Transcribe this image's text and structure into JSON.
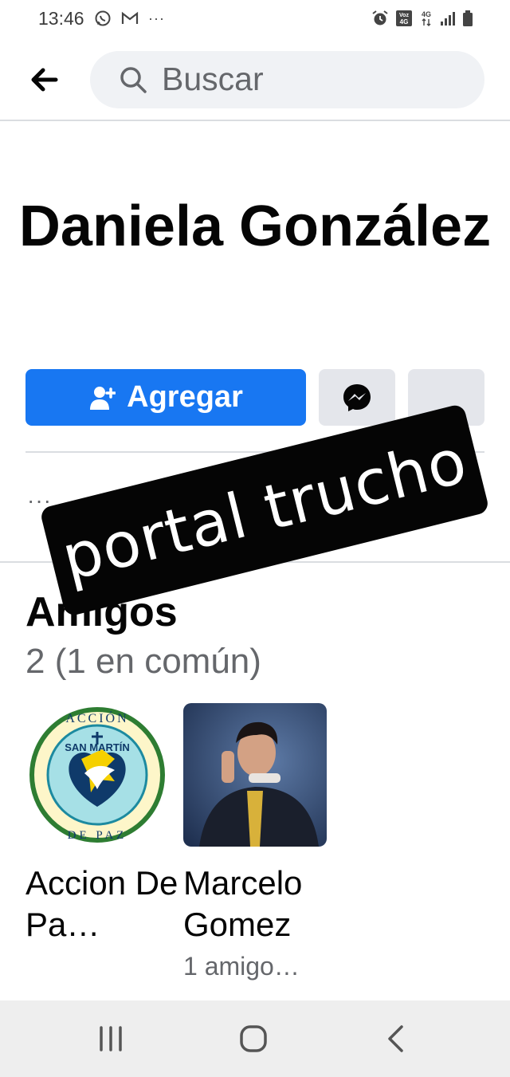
{
  "status_bar": {
    "time": "13:46",
    "dots": "···",
    "left_icons": [
      "whatsapp-icon",
      "gmail-icon"
    ],
    "right_icons": [
      "alarm-icon",
      "volte-icon",
      "4g-icon",
      "signal-icon",
      "battery-icon"
    ],
    "volte_label": "Voz 4G",
    "net_label": "4G"
  },
  "search": {
    "placeholder": "Buscar"
  },
  "profile": {
    "name": "Daniela González",
    "add_label": "Agregar",
    "info_dots": "···"
  },
  "friends": {
    "title": "Amigos",
    "count": "2 (1 en común)",
    "items": [
      {
        "name": "Accion De Pa…",
        "mutual": "",
        "photo": "accion-san-martin-de-paz-logo",
        "logo_top": "ACCIÓN",
        "logo_mid": "SAN MARTÍN",
        "logo_bottom": "DE PAZ"
      },
      {
        "name": "Marcelo Gomez",
        "mutual": "1 amigo…",
        "photo": "marcelo-gomez-photo"
      }
    ]
  },
  "watermark": {
    "text": "portal trucho"
  },
  "colors": {
    "accent": "#1877f2",
    "secondary_button": "#e4e6eb",
    "search_bg": "#f0f2f5",
    "muted_text": "#65676b",
    "nav_bg": "#eeeeee"
  }
}
